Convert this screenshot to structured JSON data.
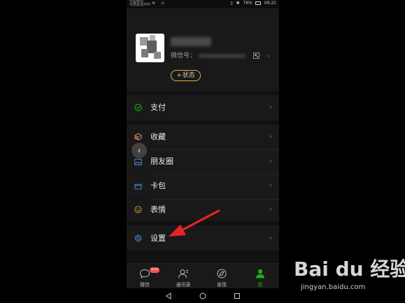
{
  "status_bar": {
    "carrier_line1": "中国移动",
    "carrier_line2": "仅限紧急呼叫",
    "battery": "76%",
    "time": "09:21",
    "icons": [
      "sim-icon",
      "wifi-icon",
      "warning-icon",
      "vibrate-icon",
      "bluetooth-icon",
      "battery-icon"
    ]
  },
  "profile": {
    "wechat_id_label": "微信号：",
    "status_plus": "+",
    "status_label": "状态"
  },
  "menu": {
    "pay": "支付",
    "favorites": "收藏",
    "moments": "朋友圈",
    "cards": "卡包",
    "stickers": "表情",
    "settings": "设置"
  },
  "tabs": {
    "chats": "微信",
    "contacts": "通讯录",
    "discover": "发现",
    "me": "我",
    "chats_badge": "•••"
  },
  "colors": {
    "accent_green": "#1aad19",
    "badge_red": "#f25453",
    "annotation_arrow": "#e8242a",
    "status_pill_gold": "#d8b24c"
  },
  "watermark": {
    "logo": "Bai du 经验",
    "url": "jingyan.baidu.com"
  }
}
